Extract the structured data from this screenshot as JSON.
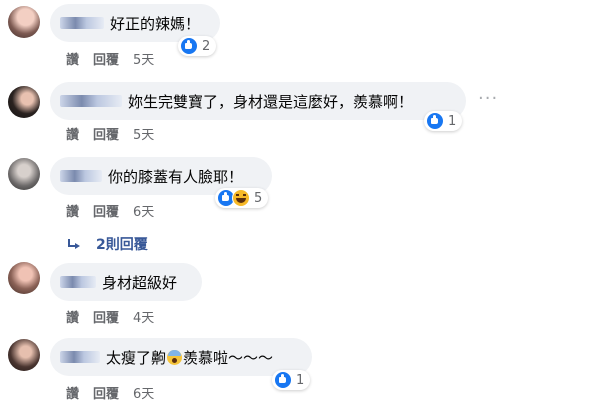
{
  "comments": [
    {
      "text": "好正的辣媽！",
      "reaction_count": "2",
      "reactions": [
        "like-icon"
      ],
      "like_label": "讚",
      "reply_label": "回覆",
      "time": "5天"
    },
    {
      "text": "妳生完雙寶了，身材還是這麼好，羨慕啊！",
      "reaction_count": "1",
      "reactions": [
        "like-icon"
      ],
      "like_label": "讚",
      "reply_label": "回覆",
      "time": "5天",
      "more": "···"
    },
    {
      "text": "你的膝蓋有人臉耶！",
      "reaction_count": "5",
      "reactions": [
        "like-icon",
        "haha-icon"
      ],
      "like_label": "讚",
      "reply_label": "回覆",
      "time": "6天",
      "replies_link": "2則回覆"
    },
    {
      "text": "身材超級好",
      "like_label": "讚",
      "reply_label": "回覆",
      "time": "4天"
    },
    {
      "text_before_emoji": "太瘦了齁",
      "text_after_emoji": "羨慕啦～～～",
      "emoji": "scream-emoji",
      "reaction_count": "1",
      "reactions": [
        "like-icon"
      ],
      "like_label": "讚",
      "reply_label": "回覆",
      "time": "6天"
    }
  ],
  "colors": {
    "bubble": "#f0f2f5",
    "meta_text": "#65676b",
    "link": "#385898",
    "like_blue": "#1877f2"
  }
}
